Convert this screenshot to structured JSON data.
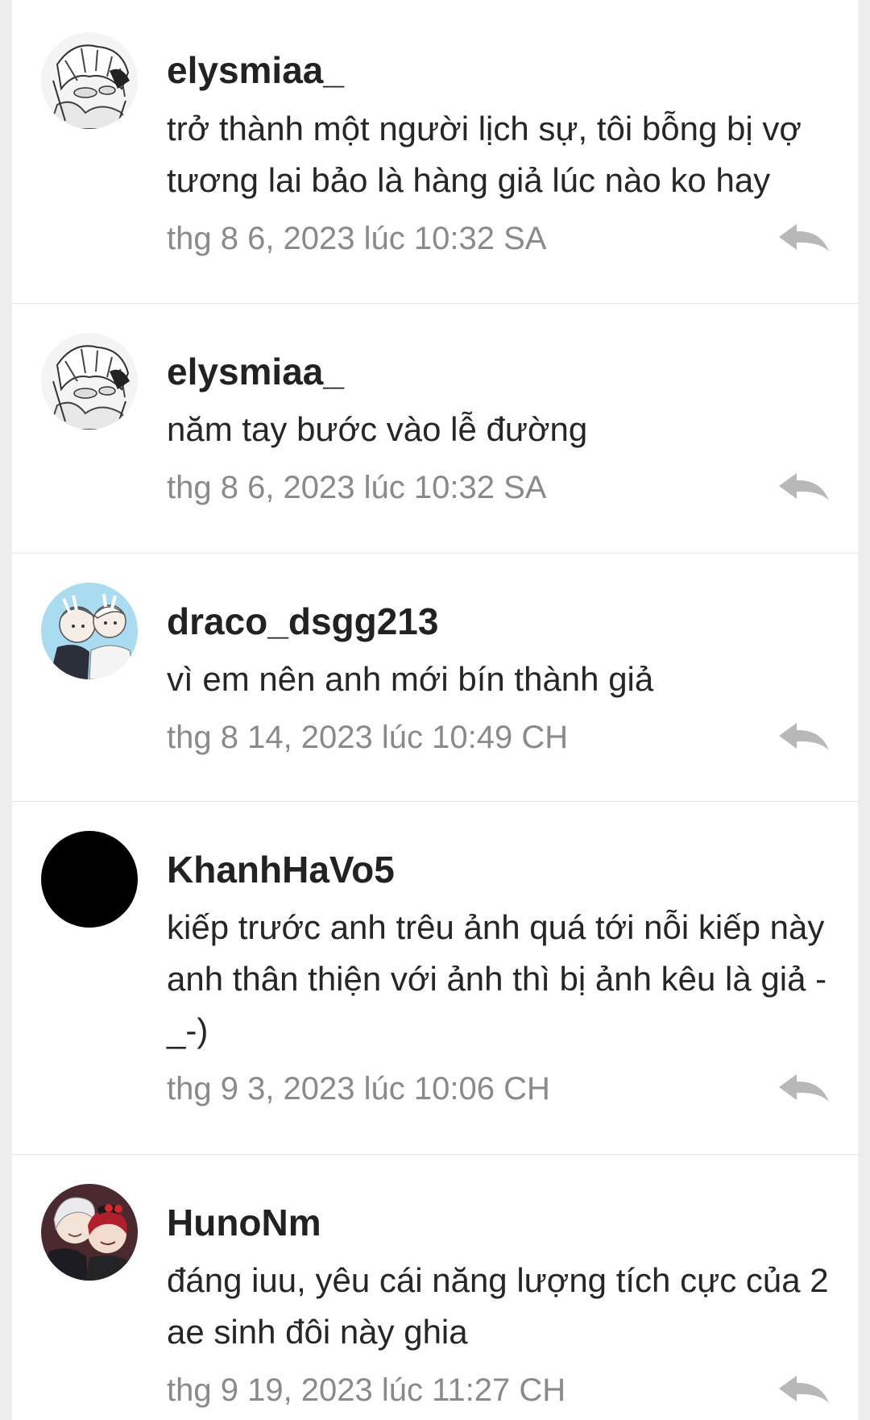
{
  "comments": [
    {
      "username": "elysmiaa_",
      "text": "trở thành một người lịch sự, tôi bỗng bị vợ tương lai bảo là hàng giả lúc nào ko hay",
      "timestamp": "thg 8 6, 2023 lúc 10:32 SA",
      "avatar": "sketch-avatar"
    },
    {
      "username": "elysmiaa_",
      "text": "năm tay bước vào lễ đường",
      "timestamp": "thg 8 6, 2023 lúc 10:32 SA",
      "avatar": "sketch-avatar"
    },
    {
      "username": "draco_dsgg213",
      "text": "vì em nên anh mới bín thành giả",
      "timestamp": "thg 8 14, 2023 lúc 10:49 CH",
      "avatar": "anime-pair-avatar"
    },
    {
      "username": "KhanhHaVo5",
      "text": "kiếp trước anh trêu ảnh quá tới nỗi kiếp này anh thân thiện với ảnh thì bị ảnh kêu là giả -_-)",
      "timestamp": "thg 9 3, 2023 lúc 10:06 CH",
      "avatar": "black-avatar"
    },
    {
      "username": "HunoNm",
      "text": "đáng iuu, yêu cái năng lượng tích cực của 2 ae sinh đôi này ghia",
      "timestamp": "thg 9 19, 2023 lúc 11:27 CH",
      "avatar": "anime-duo-avatar"
    }
  ],
  "icons": {
    "reply": "reply-arrow-icon"
  },
  "colors": {
    "username": "#222222",
    "timestamp": "#8a8a8a",
    "reply_icon": "#b8b8b8",
    "divider": "#e4e4e4"
  }
}
